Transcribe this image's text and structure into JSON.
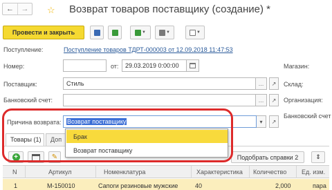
{
  "window": {
    "title": "Возврат товаров поставщику (создание) *",
    "nav_back_icon": "arrow-left",
    "nav_forward_icon": "arrow-right"
  },
  "toolbar": {
    "post_and_close_label": "Провести и закрыть"
  },
  "form": {
    "receipt_label": "Поступление:",
    "receipt_link": "Поступление товаров ТДРТ-000003 от 12.09.2018 11:47:53",
    "number_label": "Номер:",
    "number_value": "",
    "date_from_label": "от:",
    "date_value": "29.03.2019  0:00:00",
    "supplier_label": "Поставщик:",
    "supplier_value": "Стиль",
    "bank_account_label": "Банковский счет:",
    "bank_account_value": "",
    "return_reason_label": "Причина возврата:",
    "return_reason_value": "Возврат поставщику",
    "store_label": "Магазин:",
    "warehouse_label": "Склад:",
    "organization_label": "Организация:",
    "bank_account_right_label": "Банковский счет"
  },
  "dropdown": {
    "options": [
      "Брак",
      "Возврат поставщику"
    ],
    "highlighted": "Брак"
  },
  "tabs": {
    "goods_label": "Товары (1)",
    "additional_label": "Доп"
  },
  "table_toolbar": {
    "pick_certificates_label": "Подобрать справки 2"
  },
  "table": {
    "headers": [
      "N",
      "Артикул",
      "Номенклатура",
      "Характеристика",
      "Количество",
      "Ед. изм."
    ],
    "rows": [
      [
        "1",
        "М-150010",
        "Сапоги резиновые мужские",
        "40",
        "2,000",
        "пара"
      ]
    ]
  },
  "colors": {
    "primary_button": "#f5d931",
    "highlight_ring": "#dd2a2a",
    "dropdown_active": "#f8da3c",
    "selected_row": "#fbeebd",
    "link": "#2a5a9a"
  }
}
